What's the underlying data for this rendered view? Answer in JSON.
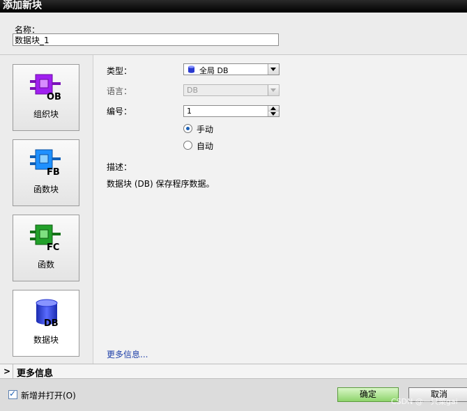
{
  "window": {
    "title": "添加新块"
  },
  "name_field": {
    "label": "名称：",
    "value": "数据块_1"
  },
  "block_types": [
    {
      "label": "组织块",
      "icon": "ob-block-icon",
      "badge": "OB",
      "color": "#a020f0"
    },
    {
      "label": "函数块",
      "icon": "fb-block-icon",
      "badge": "FB",
      "color": "#1e90ff"
    },
    {
      "label": "函数",
      "icon": "fc-block-icon",
      "badge": "FC",
      "color": "#22a02a"
    },
    {
      "label": "数据块",
      "icon": "db-block-icon",
      "badge": "DB",
      "color": "#2233cc",
      "selected": true
    }
  ],
  "form": {
    "type": {
      "label": "类型：",
      "value": "全局 DB"
    },
    "language": {
      "label": "语言：",
      "value": "DB"
    },
    "number": {
      "label": "编号：",
      "value": "1"
    },
    "numbering": {
      "manual": "手动",
      "auto": "自动",
      "selected": "manual"
    },
    "description": {
      "label": "描述：",
      "text": "数据块 (DB) 保存程序数据。"
    },
    "more_link": "更多信息..."
  },
  "more_info_bar": {
    "label": "更多信息"
  },
  "footer": {
    "add_open_label": "新增并打开(O)",
    "add_open_checked": true,
    "ok_label": "确定",
    "cancel_label": "取消"
  },
  "watermark": "CSDN @一只菜gai"
}
